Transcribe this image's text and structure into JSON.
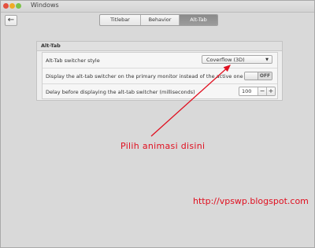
{
  "window": {
    "title": "Windows"
  },
  "tabs": [
    {
      "label": "Titlebar",
      "active": false
    },
    {
      "label": "Behavior",
      "active": false
    },
    {
      "label": "Alt-Tab",
      "active": true
    }
  ],
  "section": {
    "title": "Alt-Tab",
    "rows": [
      {
        "label": "Alt-Tab switcher style",
        "control": "dropdown",
        "value": "Coverflow (3D)"
      },
      {
        "label": "Display the alt-tab switcher on the primary monitor instead of the active one",
        "control": "toggle",
        "value": "OFF"
      },
      {
        "label": "Delay before displaying the alt-tab switcher (milliseconds)",
        "control": "spinner",
        "value": "100",
        "minus": "−",
        "plus": "+"
      }
    ]
  },
  "annotation": {
    "text": "Pilih animasi disini",
    "color": "#e01020"
  },
  "watermark": {
    "text": "http://vpswp.blogspot.com"
  },
  "icons": {
    "back": "back-arrow-icon",
    "dropdown": "chevron-down-icon"
  }
}
